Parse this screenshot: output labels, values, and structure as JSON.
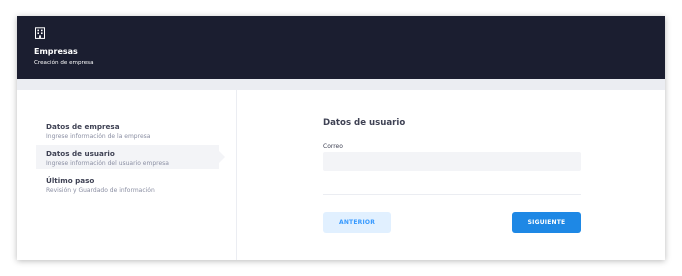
{
  "header": {
    "icon": "building-icon",
    "title": "Empresas",
    "subtitle": "Creación de empresa"
  },
  "steps": [
    {
      "label": "Datos de empresa",
      "description": "Ingrese información de la empresa",
      "active": false
    },
    {
      "label": "Datos de usuario",
      "description": "Ingrese información del usuario empresa",
      "active": true
    },
    {
      "label": "Último paso",
      "description": "Revisión y Guardado de información",
      "active": false
    }
  ],
  "form": {
    "title": "Datos de usuario",
    "email_label": "Correo",
    "email_value": "",
    "email_placeholder": ""
  },
  "buttons": {
    "prev_label": "ANTERIOR",
    "next_label": "SIGUIENTE"
  },
  "colors": {
    "header_bg": "#1b1e30",
    "primary": "#1e88e5",
    "secondary_bg": "#e1f0ff",
    "secondary_text": "#3699ff"
  }
}
